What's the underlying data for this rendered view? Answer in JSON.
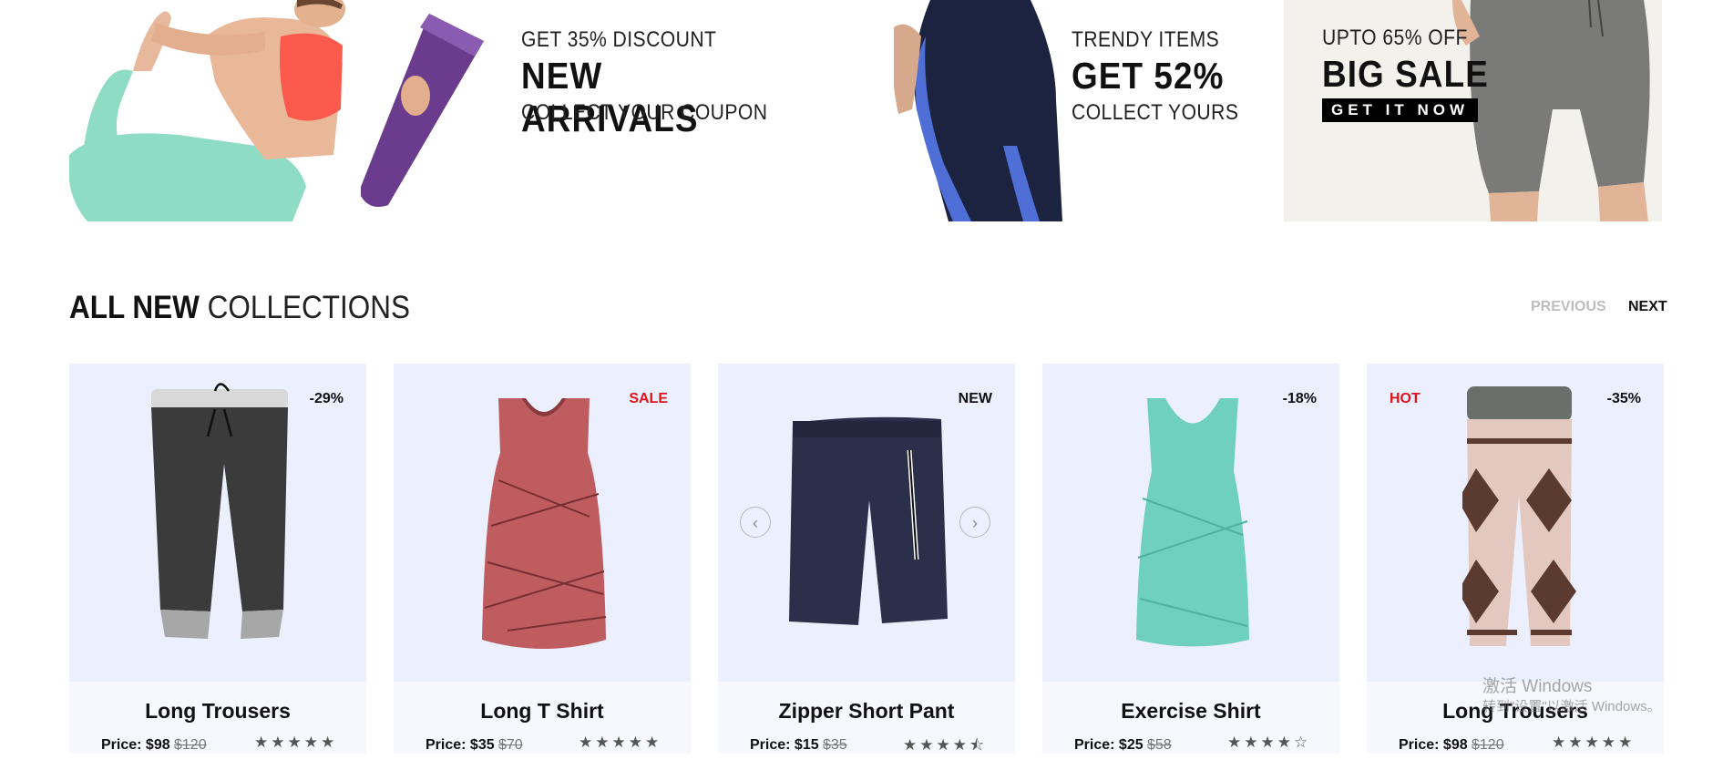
{
  "banners": [
    {
      "line1": "GET 35% DISCOUNT",
      "line2": "NEW ARRIVALS",
      "line3": "COLLECT YOUR COUPON"
    },
    {
      "line1": "TRENDY ITEMS",
      "line2": "GET 52%",
      "line3": "COLLECT YOURS"
    },
    {
      "line1": "UPTO 65% OFF",
      "line2": "BIG SALE",
      "button": "GET IT NOW"
    }
  ],
  "section": {
    "title_bold": "ALL NEW",
    "title_light": "COLLECTIONS",
    "prev_label": "PREVIOUS",
    "next_label": "NEXT"
  },
  "products": [
    {
      "name": "Long Trousers",
      "price": "Price: $98",
      "old_price": "$120",
      "badge": "-29%",
      "rating": "★★★★★"
    },
    {
      "name": "Long T Shirt",
      "price": "Price: $35",
      "old_price": "$70",
      "badge": "SALE",
      "rating": "★★★★★"
    },
    {
      "name": "Zipper Short Pant",
      "price": "Price: $15",
      "old_price": "$35",
      "badge": "NEW",
      "rating": "★★★★⯪",
      "arrow_prev": "‹",
      "arrow_next": "›"
    },
    {
      "name": "Exercise Shirt",
      "price": "Price: $25",
      "old_price": "$58",
      "badge": "-18%",
      "rating": "★★★★☆"
    },
    {
      "name": "Long Trousers",
      "price": "Price: $98",
      "old_price": "$120",
      "badge_left": "HOT",
      "badge": "-35%",
      "rating": "★★★★★"
    }
  ],
  "watermark": {
    "line1": "激活 Windows",
    "line2": "转到\"设置\"以激活 Windows。"
  },
  "colors": {
    "card_bg": "#ecf0fe",
    "card_info_bg": "#f7f8fd",
    "badge_red": "#e1131a",
    "banner3_bg": "#f2f1ec"
  }
}
